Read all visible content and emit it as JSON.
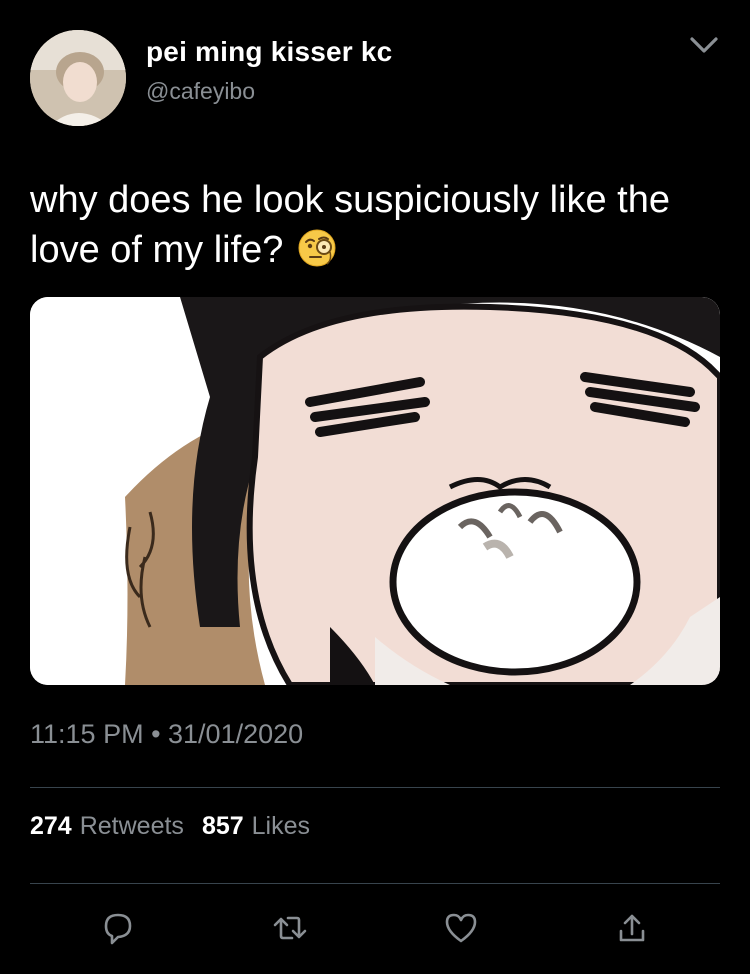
{
  "author": {
    "display_name": "pei ming kisser kc",
    "handle": "@cafeyibo",
    "avatar_icon": "profile-photo"
  },
  "tweet": {
    "text": "why does he look suspiciously like the love of my life?",
    "emoji": "face-with-monocle-emoji",
    "media_description_icon": "chibi-cartoon-eating-bun"
  },
  "meta": {
    "timestamp": "11:15 PM • 31/01/2020"
  },
  "stats": {
    "retweets_count": "274",
    "retweets_label": "Retweets",
    "likes_count": "857",
    "likes_label": "Likes"
  },
  "actions": [
    "reply-icon",
    "retweet-icon",
    "like-icon",
    "share-icon"
  ],
  "colors": {
    "background": "#000000",
    "text_primary": "#ffffff",
    "text_secondary": "#8a8f94",
    "divider": "#38444d"
  }
}
